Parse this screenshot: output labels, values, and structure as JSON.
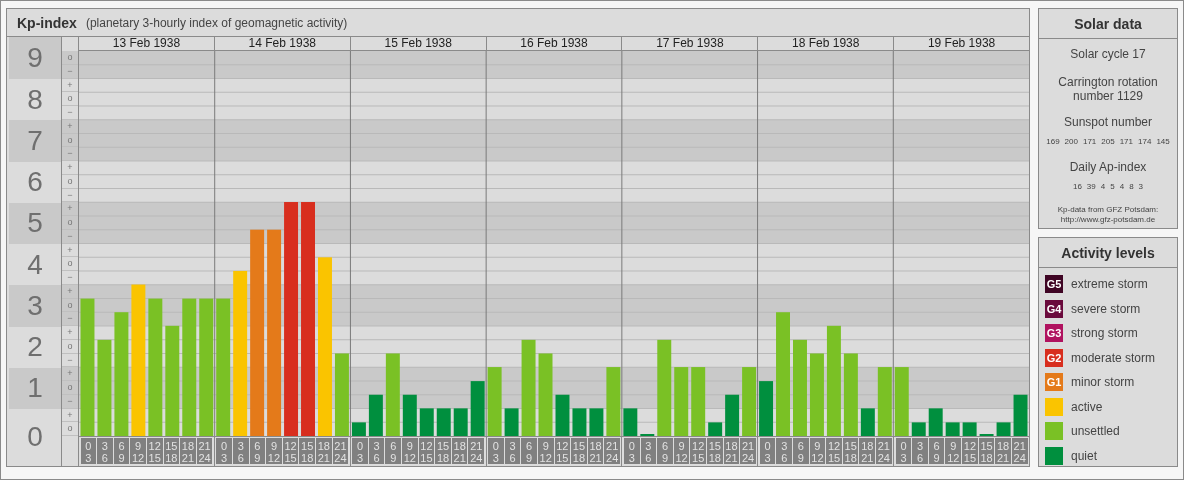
{
  "kp_panel": {
    "title": "Kp-index",
    "subtitle": "(planetary 3-hourly index of geomagnetic activity)",
    "days": [
      "13 Feb 1938",
      "14 Feb 1938",
      "15 Feb 1938",
      "16 Feb 1938",
      "17 Feb 1938",
      "18 Feb 1938",
      "19 Feb 1938"
    ],
    "subdivision_labels": [
      "o",
      "−",
      "+",
      "o",
      "−",
      "+",
      "o",
      "−",
      "+",
      "o",
      "−",
      "+",
      "o",
      "−",
      "+",
      "o",
      "−",
      "+",
      "o",
      "−",
      "+",
      "o",
      "−",
      "+",
      "o",
      "−",
      "+",
      "o"
    ],
    "chart_data": {
      "type": "bar",
      "grid": true,
      "ylim": [
        0,
        9.33
      ],
      "yticks": [
        0,
        1,
        2,
        3,
        4,
        5,
        6,
        7,
        8,
        9
      ],
      "categories": [
        "0 3",
        "3 6",
        "6 9",
        "9 12",
        "12 15",
        "15 18",
        "18 21",
        "21 24",
        "0 3",
        "3 6",
        "6 9",
        "9 12",
        "12 15",
        "15 18",
        "18 21",
        "21 24",
        "0 3",
        "3 6",
        "6 9",
        "9 12",
        "12 15",
        "15 18",
        "18 21",
        "21 24",
        "0 3",
        "3 6",
        "6 9",
        "9 12",
        "12 15",
        "15 18",
        "18 21",
        "21 24",
        "0 3",
        "3 6",
        "6 9",
        "9 12",
        "12 15",
        "15 18",
        "18 21",
        "21 24",
        "0 3",
        "3 6",
        "6 9",
        "9 12",
        "12 15",
        "15 18",
        "18 21",
        "21 24",
        "0 3",
        "3 6",
        "6 9",
        "9 12",
        "12 15",
        "15 18",
        "18 21",
        "21 24"
      ],
      "values": [
        3.33,
        2.33,
        3,
        3.67,
        3.33,
        2.67,
        3.33,
        3.33,
        3.33,
        4,
        5,
        5,
        5.67,
        5.67,
        4.33,
        2,
        0.33,
        1,
        2,
        1,
        0.67,
        0.67,
        0.67,
        1.33,
        1.67,
        0.67,
        2.33,
        2,
        1,
        0.67,
        0.67,
        1.67,
        0.67,
        0,
        2.33,
        1.67,
        1.67,
        0.33,
        1,
        1.67,
        1.33,
        3,
        2.33,
        2,
        2.67,
        2,
        0.67,
        1.67,
        1.67,
        0.33,
        0.67,
        0.33,
        0.33,
        0,
        0.33,
        1
      ]
    }
  },
  "solar_data": {
    "title": "Solar data",
    "solar_cycle": "Solar cycle 17",
    "carrington": "Carrington rotation number 1129",
    "sunspot_title": "Sunspot number",
    "sunspot_numbers": [
      "169",
      "200",
      "171",
      "205",
      "171",
      "174",
      "145"
    ],
    "ap_title": "Daily Ap-index",
    "ap_values": [
      "16",
      "39",
      "4",
      "5",
      "4",
      "8",
      "3"
    ],
    "source_note": "Kp-data from GFZ Potsdam:",
    "source_url": "http://www.gfz-potsdam.de"
  },
  "activity_levels": {
    "title": "Activity levels",
    "items": [
      {
        "badge": "G5",
        "label": "extreme storm",
        "color": "#3f0524"
      },
      {
        "badge": "G4",
        "label": "severe storm",
        "color": "#6a0a3c"
      },
      {
        "badge": "G3",
        "label": "strong storm",
        "color": "#b0125f"
      },
      {
        "badge": "G2",
        "label": "moderate storm",
        "color": "#d82e1e"
      },
      {
        "badge": "G1",
        "label": "minor storm",
        "color": "#e47a1a"
      },
      {
        "label": "active",
        "color": "#fac400"
      },
      {
        "label": "unsettled",
        "color": "#7ac125"
      },
      {
        "label": "quiet",
        "color": "#008f3e"
      }
    ]
  }
}
